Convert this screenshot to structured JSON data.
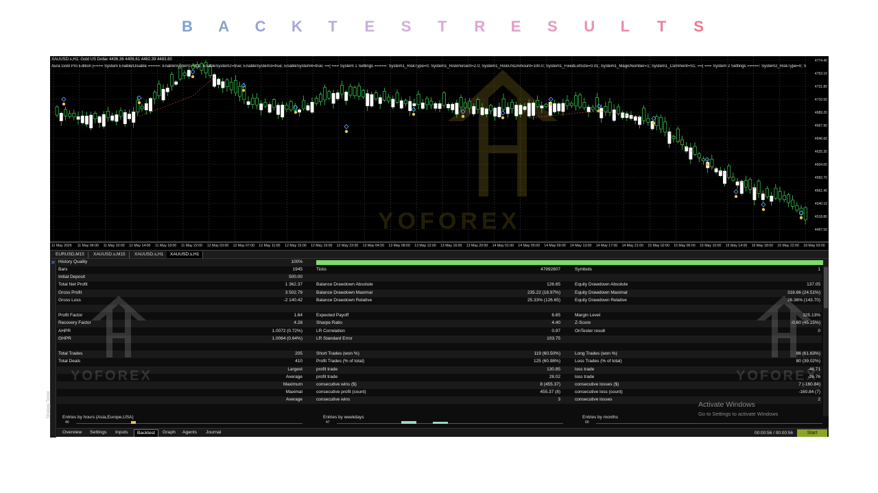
{
  "page_title_letters": [
    {
      "ch": "B",
      "color": "#7f9fd0"
    },
    {
      "ch": "A",
      "color": "#8ba0d2"
    },
    {
      "ch": "C",
      "color": "#9aa3d5"
    },
    {
      "ch": "K",
      "color": "#a8a6d8"
    },
    {
      "ch": "T",
      "color": "#b8aadb"
    },
    {
      "ch": "E",
      "color": "#c7aedd"
    },
    {
      "ch": "S",
      "color": "#d3acdb"
    },
    {
      "ch": "T",
      "color": "#dca8d6"
    },
    {
      "ch": "R",
      "color": "#e2a2cf"
    },
    {
      "ch": "E",
      "color": "#e59cc6"
    },
    {
      "ch": "S",
      "color": "#e896bd"
    },
    {
      "ch": "U",
      "color": "#ea8fb2"
    },
    {
      "ch": "L",
      "color": "#ec88a7"
    },
    {
      "ch": "T",
      "color": "#ee7f9b"
    },
    {
      "ch": "S",
      "color": "#f0768e"
    }
  ],
  "chart": {
    "info_line": "XAUUSD.s,H1:  Gold US Dollar  4406.36 4406.61 4482.39 4483.80",
    "params_line": "Aura Gold Pro Edition |==== System Enable/Disable =====: EnableSystem1=true; EnableSystem2=true; EnableSystem3=true; EnableSystem4=true;  ==| === System 1 Settings =====: System1_RiskType=0; System1_RiskPercent=2.0; System1_RiskUSDAmount=100.0; System1_FixedLotSize=0.01; System1_MagicNumber=1; System1_Comment=S1;  ==| === System 2 Settings =====: System2_RiskType=0; System2_RiskPercent=2",
    "watermark": "YOFOREX",
    "price_labels": [
      "4774.40",
      "4753.10",
      "4731.80",
      "4710.50",
      "4689.20",
      "4667.90",
      "4646.60",
      "4625.30",
      "4604.00",
      "4582.70",
      "4561.40",
      "4540.10",
      "4518.80",
      "4497.50"
    ],
    "time_labels": [
      "11 May 2026",
      "11 May 06:00",
      "11 May 10:00",
      "11 May 14:00",
      "11 May 18:00",
      "11 May 22:00",
      "12 May 03:00",
      "12 May 07:00",
      "12 May 11:00",
      "12 May 15:00",
      "12 May 19:00",
      "12 May 23:00",
      "13 May 04:00",
      "13 May 08:00",
      "13 May 12:00",
      "13 May 16:00",
      "13 May 20:00",
      "14 May 01:00",
      "14 May 05:00",
      "14 May 09:00",
      "14 May 13:00",
      "14 May 17:00",
      "14 May 21:00",
      "15 May 02:00",
      "15 May 06:00",
      "15 May 10:00",
      "15 May 14:00",
      "15 May 18:00",
      "15 May 22:00",
      "18 May 03:00"
    ]
  },
  "symbol_tabs": [
    "EURUSD,M15",
    "XAUUSD.s,M15",
    "XAUUSD.s,H1",
    "XAUUSD.s,H1"
  ],
  "report": {
    "side_label": "Strategy Tester",
    "history_quality": {
      "label": "History Quality",
      "value": "100%",
      "fraction": 1.0
    },
    "col1": [
      {
        "label": "Bars",
        "value": "1945"
      },
      {
        "label": "Initial Deposit",
        "value": "500.00"
      },
      {
        "label": "Total Net Profit",
        "value": "1 362.37"
      },
      {
        "label": "Gross Profit",
        "value": "3 502.79"
      },
      {
        "label": "Gross Loss",
        "value": "-2 140.42"
      },
      {
        "label": "",
        "value": ""
      },
      {
        "label": "Profit Factor",
        "value": "1.64"
      },
      {
        "label": "Recovery Factor",
        "value": "4.28"
      },
      {
        "label": "AHPR",
        "value": "1.0072 (0.72%)"
      },
      {
        "label": "GHPR",
        "value": "1.0064 (0.64%)"
      },
      {
        "label": "",
        "value": ""
      },
      {
        "label": "Total Trades",
        "value": "205"
      },
      {
        "label": "Total Deals",
        "value": "410"
      },
      {
        "label": "Largest",
        "value": ""
      },
      {
        "label": "Average",
        "value": ""
      },
      {
        "label": "Maximum",
        "value": ""
      },
      {
        "label": "Maximal",
        "value": ""
      },
      {
        "label": "Average",
        "value": ""
      }
    ],
    "col2": [
      {
        "label": "Ticks",
        "value": "47992807"
      },
      {
        "label": "",
        "value": ""
      },
      {
        "label": "Balance Drawdown Absolute",
        "value": "126.65"
      },
      {
        "label": "Balance Drawdown Maximal",
        "value": "235.22 (18.97%)"
      },
      {
        "label": "Balance Drawdown Relative",
        "value": "25.33% (126.65)"
      },
      {
        "label": "",
        "value": ""
      },
      {
        "label": "Expected Payoff",
        "value": "6.65"
      },
      {
        "label": "Sharpe Ratio",
        "value": "4.40"
      },
      {
        "label": "LR Correlation",
        "value": "0.97"
      },
      {
        "label": "LR Standard Error",
        "value": "103.75"
      },
      {
        "label": "",
        "value": ""
      },
      {
        "label": "Short Trades (won %)",
        "value": "119 (60.50%)"
      },
      {
        "label": "Profit Trades (% of total)",
        "value": "125 (60.98%)"
      },
      {
        "label": "profit trade",
        "value": "130.85"
      },
      {
        "label": "profit trade",
        "value": "28.02"
      },
      {
        "label": "consecutive wins ($)",
        "value": "8 (455.37)"
      },
      {
        "label": "consecutive profit (count)",
        "value": "455.37 (8)"
      },
      {
        "label": "consecutive wins",
        "value": "3"
      }
    ],
    "col3": [
      {
        "label": "Symbols",
        "value": "1"
      },
      {
        "label": "",
        "value": ""
      },
      {
        "label": "Equity Drawdown Absolute",
        "value": "137.05"
      },
      {
        "label": "Equity Drawdown Maximal",
        "value": "318.66 (24.51%)"
      },
      {
        "label": "Equity Drawdown Relative",
        "value": "28.36% (143.70)"
      },
      {
        "label": "",
        "value": ""
      },
      {
        "label": "Margin Level",
        "value": "325.13%"
      },
      {
        "label": "Z-Score",
        "value": "-0.60 (45.15%)"
      },
      {
        "label": "OnTester result",
        "value": "0"
      },
      {
        "label": "",
        "value": ""
      },
      {
        "label": "",
        "value": ""
      },
      {
        "label": "Long Trades (won %)",
        "value": "86 (61.63%)"
      },
      {
        "label": "Loss Trades (% of total)",
        "value": "80 (39.02%)"
      },
      {
        "label": "loss trade",
        "value": "-46.71"
      },
      {
        "label": "loss trade",
        "value": "-26.76"
      },
      {
        "label": "consecutive losses ($)",
        "value": "7 (-160.84)"
      },
      {
        "label": "consecutive loss (count)",
        "value": "-160.84 (7)"
      },
      {
        "label": "consecutive losses",
        "value": "2"
      }
    ],
    "entries": [
      {
        "title": "Entries by hours (Asia,Europe,USA)",
        "axis": "40"
      },
      {
        "title": "Entries by weekdays",
        "axis": "47"
      },
      {
        "title": "Entries by months",
        "axis": "60"
      }
    ],
    "watermark": "YOFOREX"
  },
  "bottom_tabs": [
    "Overview",
    "Settings",
    "Inputs",
    "Backtest",
    "Graph",
    "Agents",
    "Journal"
  ],
  "active_bottom_tab": "Backtest",
  "timer": "00:00:56 / 00:00:56",
  "start_label": "Start",
  "activate": {
    "title": "Activate Windows",
    "subtitle": "Go to Settings to activate Windows"
  }
}
